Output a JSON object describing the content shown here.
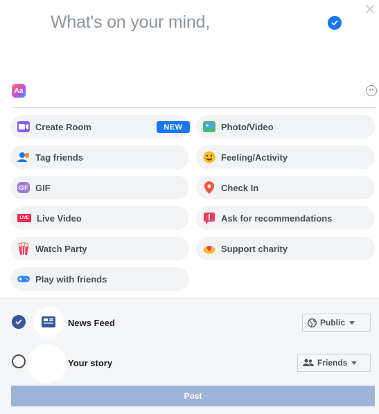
{
  "composer": {
    "prompt": "What's on your mind,"
  },
  "options": {
    "create_room": "Create Room",
    "new_badge": "NEW",
    "photo_video": "Photo/Video",
    "tag_friends": "Tag friends",
    "feeling_activity": "Feeling/Activity",
    "gif": "GIF",
    "check_in": "Check In",
    "live_video": "Live Video",
    "live_icon_text": "LIVE",
    "ask_recommendations": "Ask for recommendations",
    "watch_party": "Watch Party",
    "support_charity": "Support charity",
    "play_with_friends": "Play with friends"
  },
  "audience": {
    "news_feed_label": "News Feed",
    "news_feed_privacy": "Public",
    "story_label": "Your story",
    "story_privacy": "Friends",
    "post_label": "Post"
  },
  "colors": {
    "accent": "#1877f2",
    "post_disabled": "#9cb4d8",
    "option_bg": "#f2f3f5"
  }
}
